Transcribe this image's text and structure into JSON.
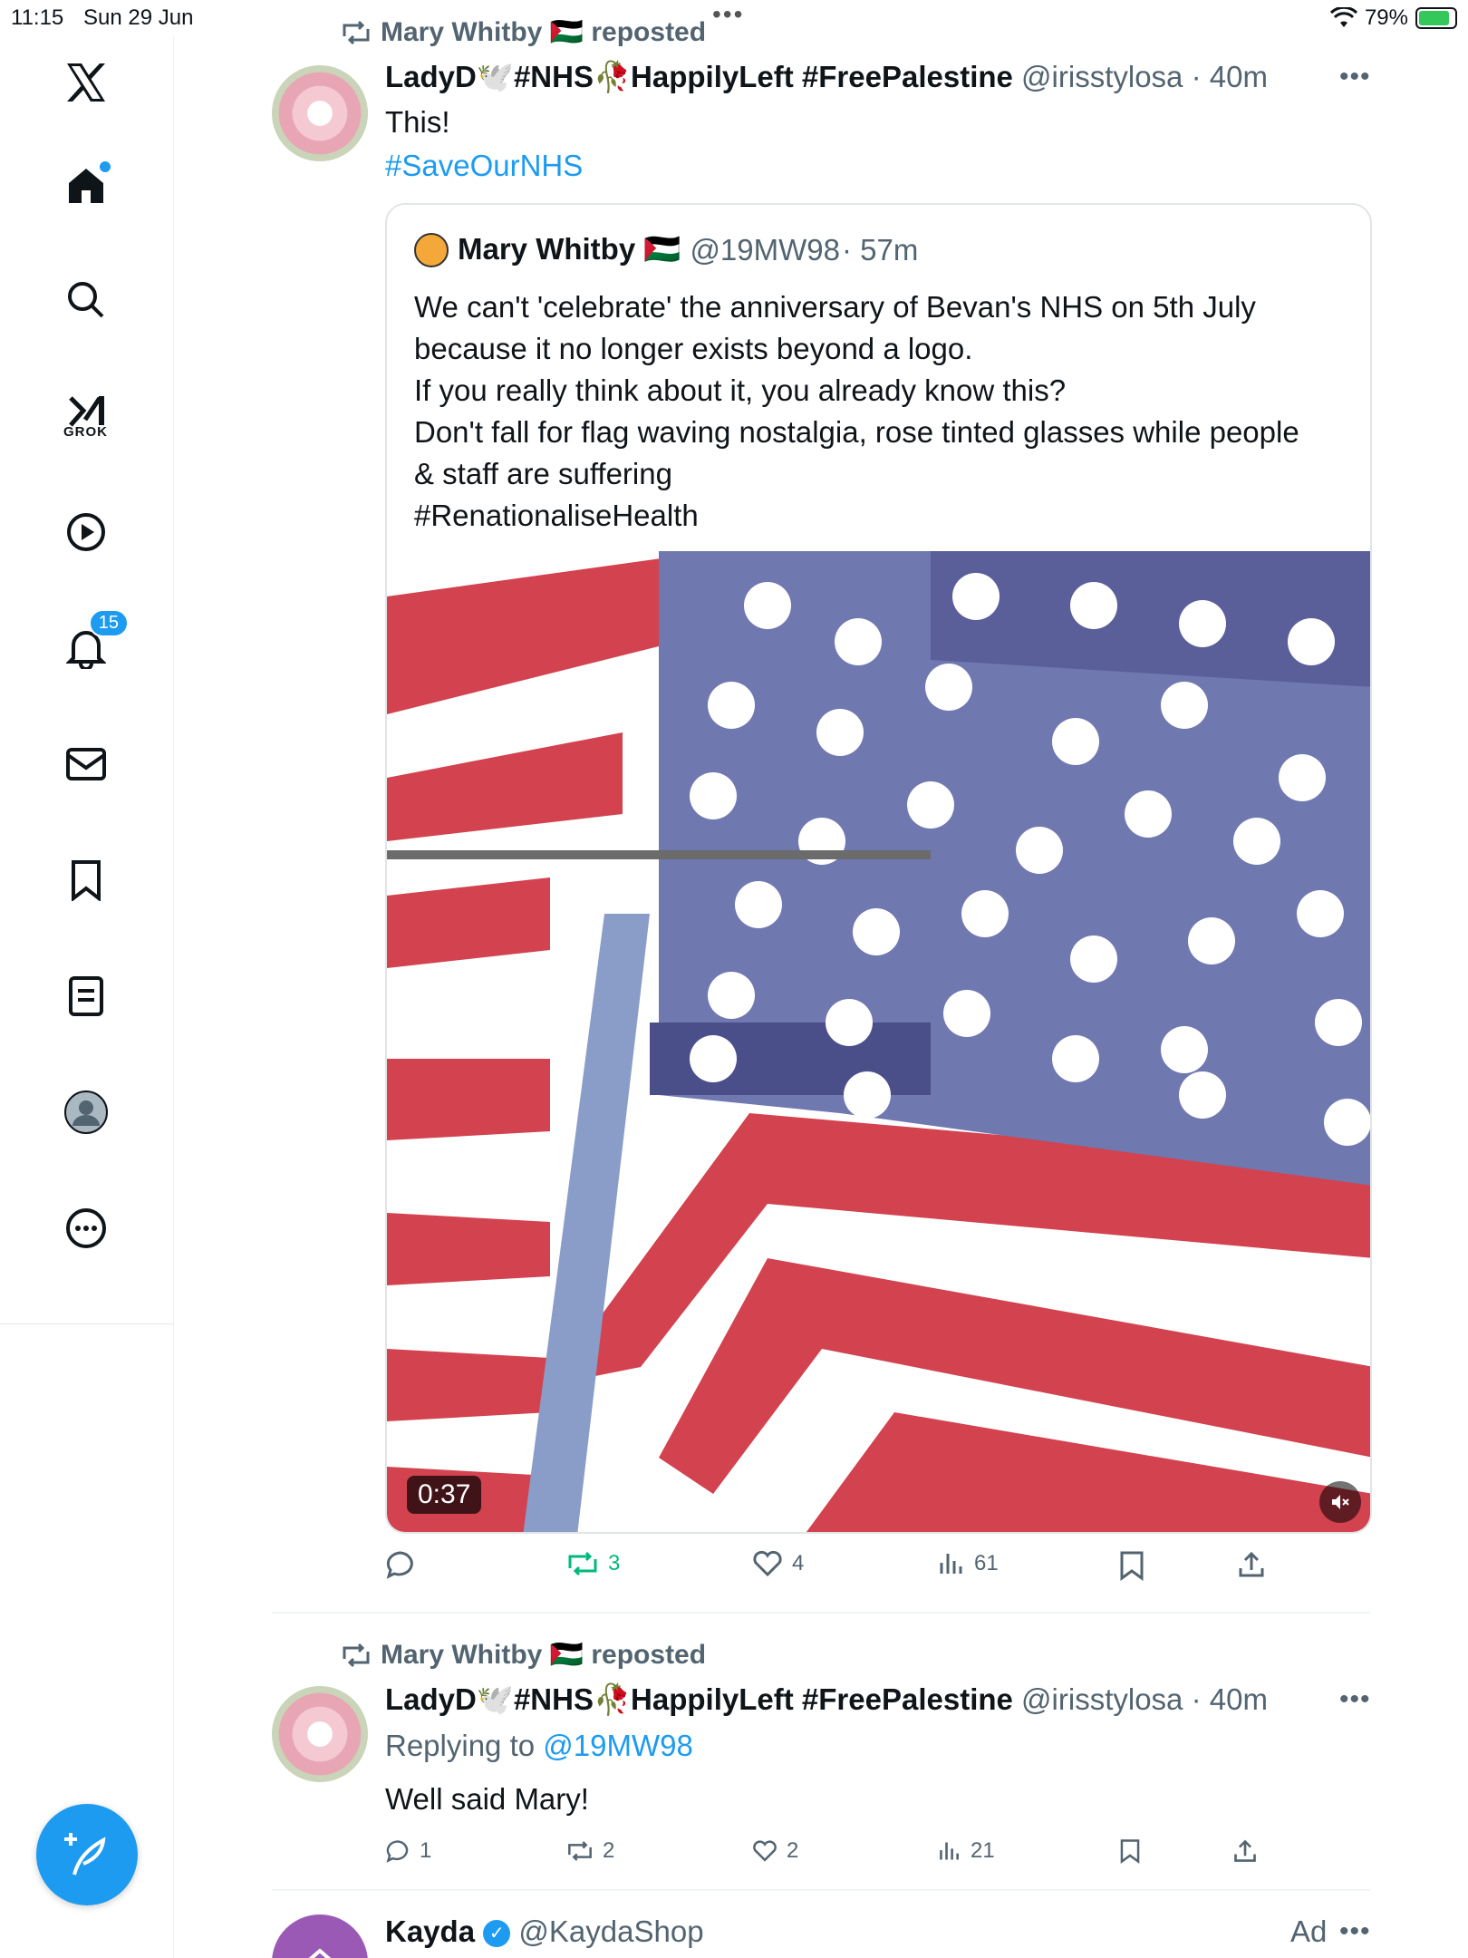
{
  "status_bar": {
    "time": "11:15",
    "date": "Sun 29 Jun",
    "battery": "79%",
    "battery_level": 0.79
  },
  "sidebar": {
    "notifications_badge": "15",
    "grok_label": "GROK"
  },
  "tweet1": {
    "repost_label": "Mary Whitby 🇵🇸 reposted",
    "name": "LadyD🕊️#NHS🥀HappilyLeft #FreePalestine",
    "handle": "@irisstylosa",
    "time": "· 40m",
    "text": "This!",
    "hashtag": "#SaveOurNHS",
    "quote": {
      "name": "Mary Whitby 🇵🇸",
      "handle": "@19MW98",
      "time": "· 57m",
      "lines": [
        "We can't 'celebrate' the anniversary of Bevan's NHS on 5th July",
        "because it no longer exists beyond a logo.",
        "If you really think about it, you already know this?",
        "Don't fall for flag waving nostalgia, rose tinted glasses while people",
        "& staff are suffering",
        "#RenationaliseHealth"
      ],
      "video_duration": "0:37"
    },
    "actions": {
      "replies": "",
      "reposts": "3",
      "likes": "4",
      "views": "61"
    }
  },
  "tweet2": {
    "repost_label": "Mary Whitby 🇵🇸 reposted",
    "name": "LadyD🕊️#NHS🥀HappilyLeft #FreePalestine",
    "handle": "@irisstylosa",
    "time": "· 40m",
    "replying_prefix": "Replying to",
    "replying_handle": "@19MW98",
    "text": "Well said Mary!",
    "actions": {
      "replies": "1",
      "reposts": "2",
      "likes": "2",
      "views": "21"
    }
  },
  "tweet3": {
    "name": "Kayda",
    "handle": "@KaydaShop",
    "ad_label": "Ad"
  },
  "colors": {
    "accent": "#1d9bf0",
    "repost_green": "#00ba7c",
    "muted": "#536471"
  }
}
